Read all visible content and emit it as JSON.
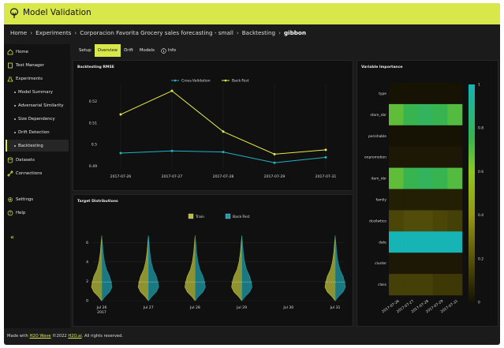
{
  "header": {
    "title": "Model Validation"
  },
  "breadcrumbs": [
    "Home",
    "Experiments",
    "Corporacion Favorita Grocery sales forecasting - small",
    "Backtesting",
    "gibbon"
  ],
  "sidebar": {
    "items": [
      {
        "label": "Home",
        "icon": "home-icon"
      },
      {
        "label": "Test Manager",
        "icon": "clipboard-icon"
      },
      {
        "label": "Experiments",
        "icon": "beaker-icon"
      },
      {
        "label": "Model Summary",
        "sub": true
      },
      {
        "label": "Adversarial Similarity",
        "sub": true
      },
      {
        "label": "Size Dependency",
        "sub": true
      },
      {
        "label": "Drift Detection",
        "sub": true
      },
      {
        "label": "Backtesting",
        "sub": true,
        "active": true
      },
      {
        "label": "Datasets",
        "icon": "database-icon"
      },
      {
        "label": "Connections",
        "icon": "connection-icon"
      },
      {
        "label": "Settings",
        "icon": "gear-icon"
      },
      {
        "label": "Help",
        "icon": "help-icon"
      }
    ],
    "collapse_label": "«"
  },
  "tabs": [
    {
      "label": "Setup"
    },
    {
      "label": "Overview",
      "active": true
    },
    {
      "label": "Drift"
    },
    {
      "label": "Models"
    },
    {
      "label": "Info",
      "icon": "info-icon"
    }
  ],
  "cards": {
    "rmse_title": "Backtesting RMSE",
    "dist_title": "Target Distributions",
    "importance_title": "Variable Importance"
  },
  "footer": {
    "prefix": "Made with",
    "wave": "H2O Wave",
    "middle": "©2022",
    "h2o": "H2O.ai",
    "suffix": ". All rights reserved."
  },
  "colors": {
    "accent": "#d8e84a",
    "cv_line": "#22b2c4",
    "bt_line": "#e6ec4a",
    "train": "#b8bd3a",
    "backtest": "#1f9aa6"
  },
  "chart_data": [
    {
      "type": "line",
      "title": "Backtesting RMSE",
      "x": [
        "2017-07-26",
        "2017-07-27",
        "2017-07-28",
        "2017-07-29",
        "2017-07-31"
      ],
      "series": [
        {
          "name": "Cross-Validation",
          "values": [
            0.496,
            0.497,
            0.4965,
            0.4915,
            0.494
          ]
        },
        {
          "name": "Back-Test",
          "values": [
            0.514,
            0.525,
            0.506,
            0.4955,
            0.4975
          ]
        }
      ],
      "yticks": [
        0.49,
        0.5,
        0.51,
        0.52
      ],
      "ytick_labels": [
        "0.49",
        "0.5",
        "0.51",
        "0.52"
      ],
      "ylim": [
        0.489,
        0.528
      ],
      "legend": "top-center",
      "grid": true
    },
    {
      "type": "violin",
      "title": "Target Distributions",
      "categories": [
        "Jul 26\n2017",
        "Jul 27",
        "Jul 28",
        "Jul 29",
        "Jul 30",
        "Jul 31"
      ],
      "has_data": [
        true,
        true,
        true,
        true,
        false,
        true
      ],
      "series": [
        {
          "name": "Train",
          "side": "left"
        },
        {
          "name": "Back-Test",
          "side": "right"
        }
      ],
      "median": 1.9,
      "max": 6.7,
      "yticks": [
        0,
        2,
        4,
        6
      ],
      "ylim": [
        0,
        7
      ],
      "legend": "top-center",
      "grid": true
    },
    {
      "type": "heatmap",
      "title": "Variable Importance",
      "rows": [
        "type",
        "store_nbr",
        "perishable",
        "onpromotion",
        "item_nbr",
        "family",
        "dcoilwtico",
        "date",
        "cluster",
        "class"
      ],
      "columns": [
        "2017-07-26",
        "2017-07-27",
        "2017-07-28",
        "2017-07-29",
        "2017-07-31"
      ],
      "values": [
        [
          0.0,
          0.0,
          0.0,
          0.0,
          0.0
        ],
        [
          0.68,
          0.75,
          0.78,
          0.75,
          0.7
        ],
        [
          0.0,
          0.0,
          0.0,
          0.0,
          0.0
        ],
        [
          0.02,
          0.02,
          0.02,
          0.02,
          0.02
        ],
        [
          0.68,
          0.75,
          0.78,
          0.75,
          0.7
        ],
        [
          0.04,
          0.04,
          0.04,
          0.04,
          0.04
        ],
        [
          0.16,
          0.18,
          0.18,
          0.16,
          0.14
        ],
        [
          1.0,
          1.0,
          1.0,
          1.0,
          1.0
        ],
        [
          0.02,
          0.02,
          0.02,
          0.02,
          0.02
        ],
        [
          0.14,
          0.14,
          0.14,
          0.12,
          0.12
        ]
      ],
      "colorbar_ticks": [
        0,
        0.2,
        0.4,
        0.6,
        0.8,
        1
      ],
      "colorbar_labels": [
        "0",
        "0.2",
        "0.4",
        "0.6",
        "0.8",
        "1"
      ]
    }
  ]
}
